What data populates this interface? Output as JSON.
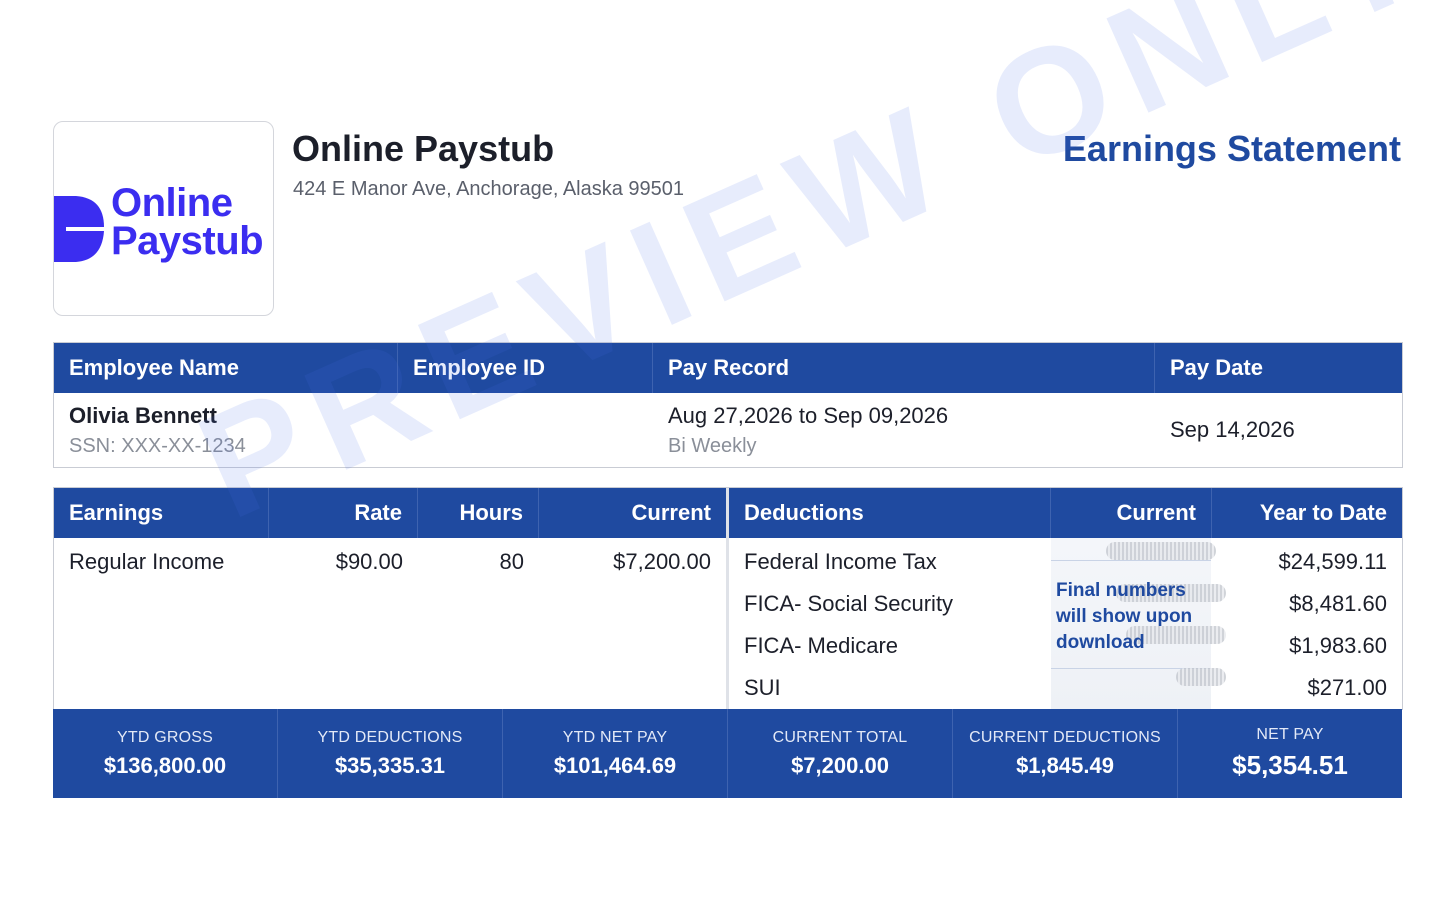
{
  "company": {
    "logo_text_line1": "Online",
    "logo_text_line2": "Paystub",
    "name": "Online Paystub",
    "address": "424 E Manor Ave, Anchorage, Alaska 99501",
    "brand_color": "#3b2df0"
  },
  "document": {
    "title": "Earnings Statement",
    "watermark": "PREVIEW ONLY",
    "accent_color": "#1f4aa0"
  },
  "employee_table": {
    "headers": [
      "Employee Name",
      "Employee ID",
      "Pay Record",
      "Pay Date"
    ],
    "employee_name": "Olivia Bennett",
    "ssn": "SSN: XXX-XX-1234",
    "employee_id": "",
    "pay_record_range": "Aug 27,2026 to Sep 09,2026",
    "pay_frequency": "Bi Weekly",
    "pay_date": "Sep 14,2026"
  },
  "earnings": {
    "headers": [
      "Earnings",
      "Rate",
      "Hours",
      "Current"
    ],
    "rows": [
      {
        "label": "Regular Income",
        "rate": "$90.00",
        "hours": "80",
        "current": "$7,200.00"
      }
    ]
  },
  "deductions": {
    "headers": [
      "Deductions",
      "Current",
      "Year to Date"
    ],
    "hidden_note": "Final numbers will show upon download",
    "rows": [
      {
        "label": "Federal Income Tax",
        "ytd": "$24,599.11"
      },
      {
        "label": "FICA- Social Security",
        "ytd": "$8,481.60"
      },
      {
        "label": "FICA- Medicare",
        "ytd": "$1,983.60"
      },
      {
        "label": "SUI",
        "ytd": "$271.00"
      }
    ]
  },
  "totals": [
    {
      "label": "YTD GROSS",
      "value": "$136,800.00"
    },
    {
      "label": "YTD DEDUCTIONS",
      "value": "$35,335.31"
    },
    {
      "label": "YTD NET PAY",
      "value": "$101,464.69"
    },
    {
      "label": "CURRENT TOTAL",
      "value": "$7,200.00"
    },
    {
      "label": "CURRENT DEDUCTIONS",
      "value": "$1,845.49"
    },
    {
      "label": "NET PAY",
      "value": "$5,354.51"
    }
  ]
}
